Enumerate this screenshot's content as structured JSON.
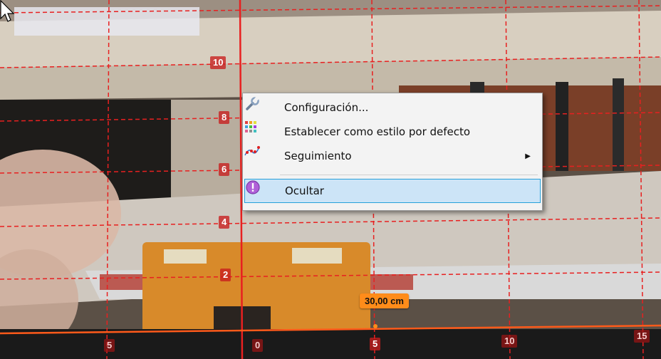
{
  "context_menu": {
    "items": [
      {
        "label": "Configuración...",
        "icon": "wrench-icon"
      },
      {
        "label": "Establecer como estilo por defecto",
        "icon": "color-palette-icon"
      },
      {
        "label": "Seguimiento",
        "icon": "trajectory-icon",
        "has_submenu": true
      },
      {
        "label": "Ocultar",
        "icon": "hide-icon",
        "highlighted": true
      }
    ]
  },
  "grid": {
    "y_labels": [
      "10",
      "8",
      "6",
      "4",
      "2"
    ],
    "x_labels": [
      "5",
      "0",
      "5",
      "10",
      "15"
    ]
  },
  "measurement": {
    "label": "30,00 cm"
  },
  "colors": {
    "grid": "#e82020",
    "accent": "#ff8c1a",
    "menu_hover": "#cce4f7"
  }
}
